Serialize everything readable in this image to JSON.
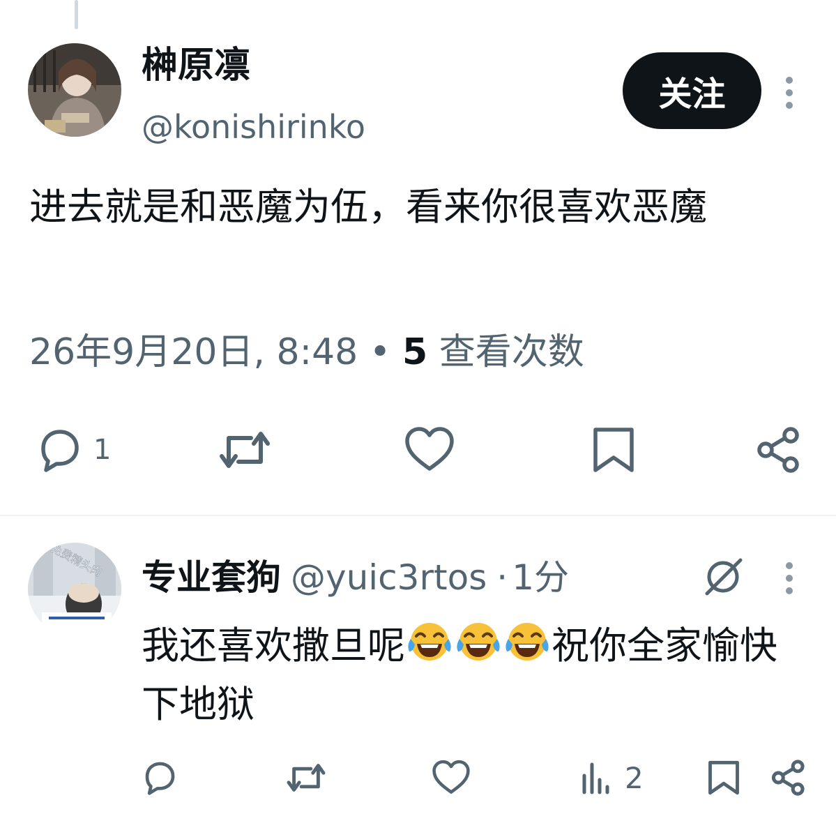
{
  "post": {
    "author_name": "榊原凛",
    "author_handle": "@konishirinko",
    "follow_label": "关注",
    "text": "进去就是和恶魔为伍，看来你很喜欢恶魔",
    "timestamp": "26年9月20日, 8:48 ",
    "views_sep": "• ",
    "views_count": "5",
    "views_label": " 查看次数",
    "actions": {
      "reply_count": "1"
    }
  },
  "reply": {
    "author_name": "专业套狗",
    "author_handle": "@yuic3rtos",
    "dot": "·",
    "time": "1分",
    "avatar_text": "免费精头肉",
    "text_before": "我还喜欢撒旦呢",
    "emoji_name": "face-with-tears-of-joy",
    "text_after": "祝你全家愉快下地狱",
    "actions": {
      "views_count": "2"
    }
  },
  "icons": [
    "reply-icon",
    "retweet-icon",
    "like-icon",
    "bookmark-icon",
    "share-icon",
    "grok-icon",
    "views-icon",
    "more-icon"
  ],
  "colors": {
    "text": "#0f1419",
    "secondary": "#536471",
    "follow_bg": "#0f1419",
    "divider": "#eff3f4"
  }
}
